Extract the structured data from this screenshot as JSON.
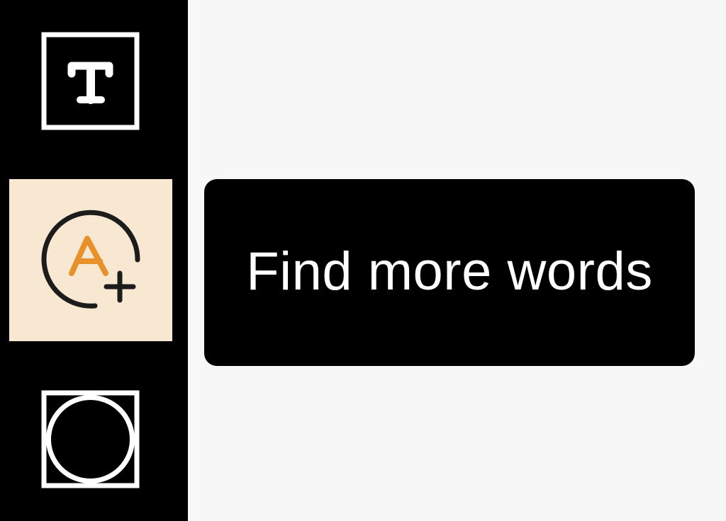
{
  "sidebar": {
    "background": "#000000",
    "tools": [
      {
        "id": "text",
        "icon": "text-tool-icon",
        "selected": false
      },
      {
        "id": "find_words",
        "icon": "add-word-icon",
        "selected": true,
        "highlight": "#f8e8d2",
        "accent": "#e8912b"
      },
      {
        "id": "circle",
        "icon": "circle-tool-icon",
        "selected": false
      }
    ]
  },
  "tooltip": {
    "text": "Find more words",
    "background": "#000000",
    "color": "#ffffff"
  },
  "canvas": {
    "background": "#f7f7f7"
  }
}
